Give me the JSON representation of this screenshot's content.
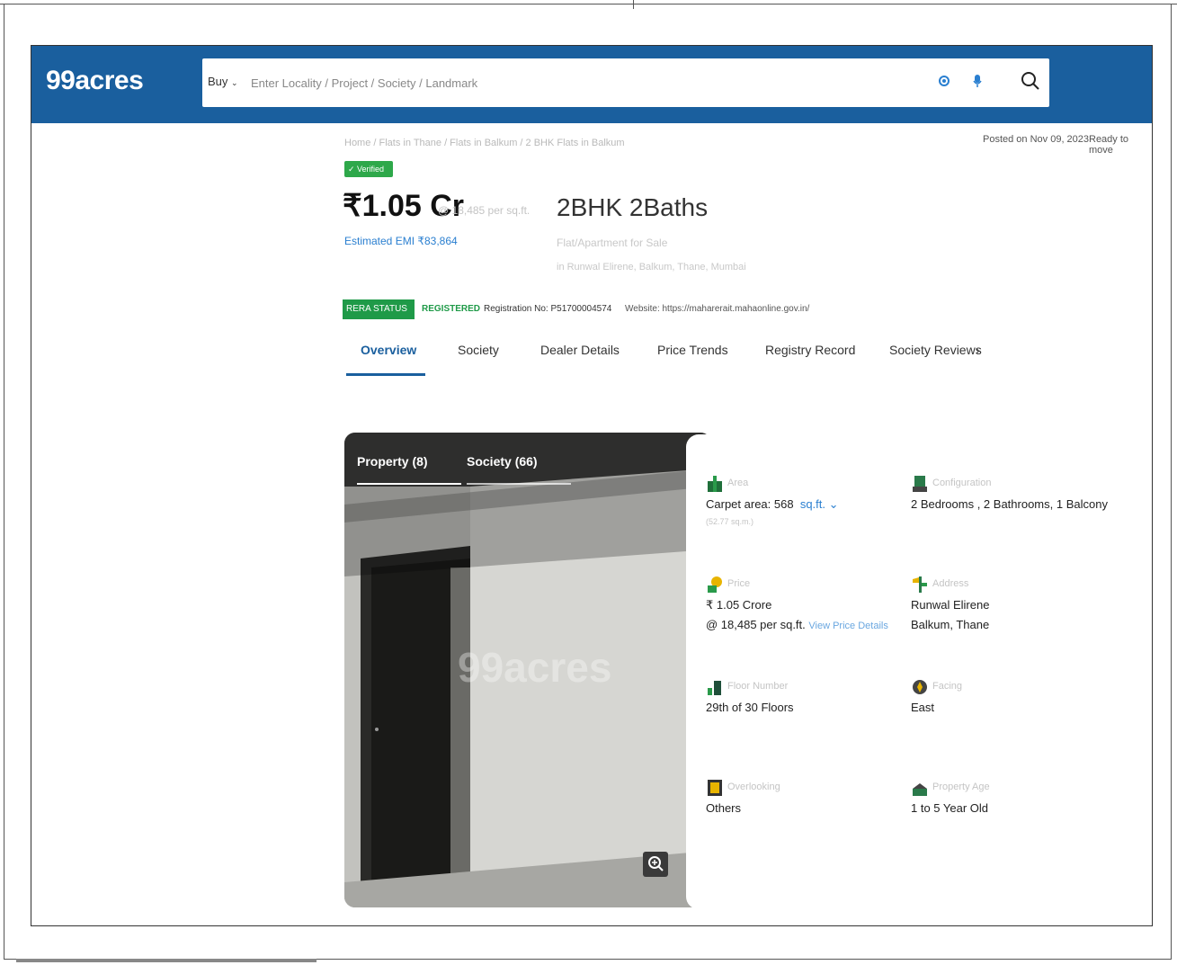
{
  "header": {
    "logo": "99acres",
    "buy_label": "Buy",
    "search_placeholder": "Enter Locality / Project / Society / Landmark"
  },
  "page": {
    "breadcrumb": "Home / Flats in Thane / Flats in Balkum / 2 BHK Flats in Balkum",
    "posted": "Posted on Nov 09, 2023",
    "status": "Ready to move",
    "verified_label": "Verified",
    "price": "₹1.05 Cr",
    "price_per_sqft": "@ 18,485 per sq.ft.",
    "emi": "Estimated EMI ₹83,864",
    "configuration_title": "2BHK 2Baths",
    "property_type": "Flat/Apartment for Sale",
    "location_line": "in Runwal Elirene, Balkum, Thane, Mumbai"
  },
  "rera": {
    "badge": "RERA STATUS",
    "status": "REGISTERED",
    "registration": "Registration No: P51700004574",
    "website": "Website: https://maharerait.mahaonline.gov.in/"
  },
  "tabs": [
    "Overview",
    "Society",
    "Dealer Details",
    "Price Trends",
    "Registry Record",
    "Society Reviews"
  ],
  "tab_more": "›",
  "photos": {
    "tab_property": "Property (8)",
    "tab_society": "Society (66)",
    "watermark": "99acres"
  },
  "details": {
    "area": {
      "label": "Area",
      "value": "Carpet area: 568",
      "unit": "sq.ft. ⌄",
      "sub": "(52.77 sq.m.)"
    },
    "configuration": {
      "label": "Configuration",
      "value": "2 Bedrooms , 2 Bathrooms, 1 Balcony"
    },
    "price": {
      "label": "Price",
      "value": "₹ 1.05 Crore",
      "value2": "@ 18,485 per sq.ft.",
      "link": "View Price Details"
    },
    "address": {
      "label": "Address",
      "value": "Runwal Elirene",
      "value2": "Balkum, Thane"
    },
    "floor": {
      "label": "Floor Number",
      "value": "29th of 30 Floors"
    },
    "facing": {
      "label": "Facing",
      "value": "East"
    },
    "overlooking": {
      "label": "Overlooking",
      "value": "Others"
    },
    "age": {
      "label": "Property Age",
      "value": "1 to 5 Year Old"
    }
  },
  "colors": {
    "header": "#1a5f9e",
    "verified": "#2ea84a",
    "rera": "#1f9a48",
    "link": "#2a7fd0"
  }
}
